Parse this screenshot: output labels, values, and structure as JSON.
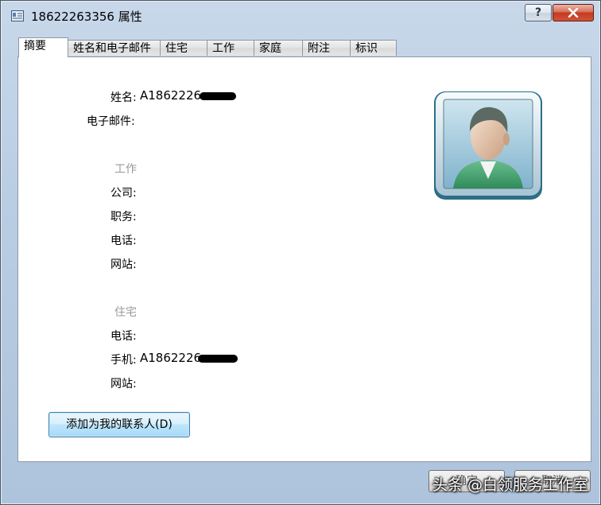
{
  "window": {
    "title": "18622263356 属性"
  },
  "tabs": [
    {
      "label": "摘要",
      "active": true
    },
    {
      "label": "姓名和电子邮件",
      "active": false
    },
    {
      "label": "住宅",
      "active": false
    },
    {
      "label": "工作",
      "active": false
    },
    {
      "label": "家庭",
      "active": false
    },
    {
      "label": "附注",
      "active": false
    },
    {
      "label": "标识",
      "active": false
    }
  ],
  "summary": {
    "name_label": "姓名:",
    "name_value": "A1862226",
    "email_label": "电子邮件:",
    "work_section": "工作",
    "company_label": "公司:",
    "job_label": "职务:",
    "work_phone_label": "电话:",
    "work_website_label": "网站:",
    "home_section": "住宅",
    "home_phone_label": "电话:",
    "mobile_label": "手机:",
    "mobile_value": "A1862226",
    "home_website_label": "网站:"
  },
  "buttons": {
    "add_contact": "添加为我的联系人(D)",
    "ok": "确定",
    "cancel": "取消",
    "help_glyph": "?"
  },
  "watermark": "头条 @白领服务工作室",
  "icons": {
    "window": "contact-card-icon",
    "avatar": "user-avatar-icon",
    "close": "close-icon"
  }
}
